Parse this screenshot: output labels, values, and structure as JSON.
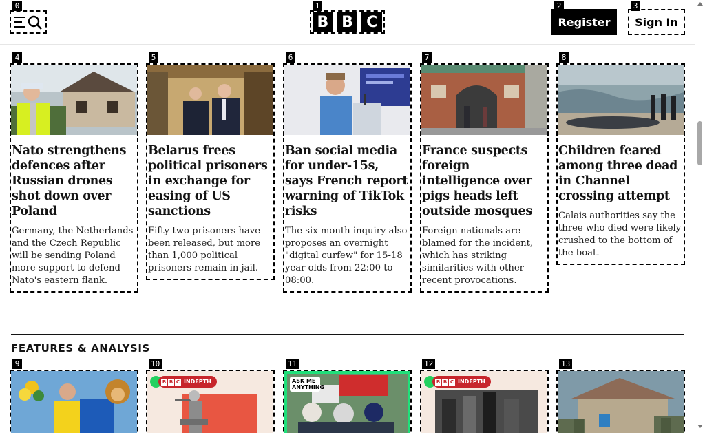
{
  "header": {
    "menu_icon": "menu-search-icon",
    "logo_letters": [
      "B",
      "B",
      "C"
    ],
    "register_label": "Register",
    "signin_label": "Sign In"
  },
  "tags": [
    "0",
    "1",
    "2",
    "3",
    "4",
    "5",
    "6",
    "7",
    "8",
    "9",
    "10",
    "11",
    "12",
    "13"
  ],
  "stories": [
    {
      "headline": "Nato strengthens defences after Russian drones shot down over Poland",
      "summary": "Germany, the Netherlands and the Czech Republic will be sending Poland more support to defend Nato's eastern flank."
    },
    {
      "headline": "Belarus frees political prisoners in exchange for easing of US sanctions",
      "summary": "Fifty-two prisoners have been released, but more than 1,000 political prisoners remain in jail."
    },
    {
      "headline": "Ban social media for under-15s, says French report warning of TikTok risks",
      "summary": "The six-month inquiry also proposes an overnight \"digital curfew\" for 15-18 year olds from 22:00 to 08:00."
    },
    {
      "headline": "France suspects foreign intelligence over pigs heads left outside mosques",
      "summary": "Foreign nationals are blamed for the incident, which has striking similarities with other recent provocations."
    },
    {
      "headline": "Children feared among three dead in Channel crossing attempt",
      "summary": "Calais authorities say the three who died were likely crushed to the bottom of the boat."
    }
  ],
  "features": {
    "section_title": "FEATURES & ANALYSIS",
    "indepth_label": "INDEPTH",
    "ama_label": "ASK ME ANYTHING",
    "colors": {
      "indepth_red": "#c7262c",
      "ama_green": "#1fe07a"
    }
  }
}
